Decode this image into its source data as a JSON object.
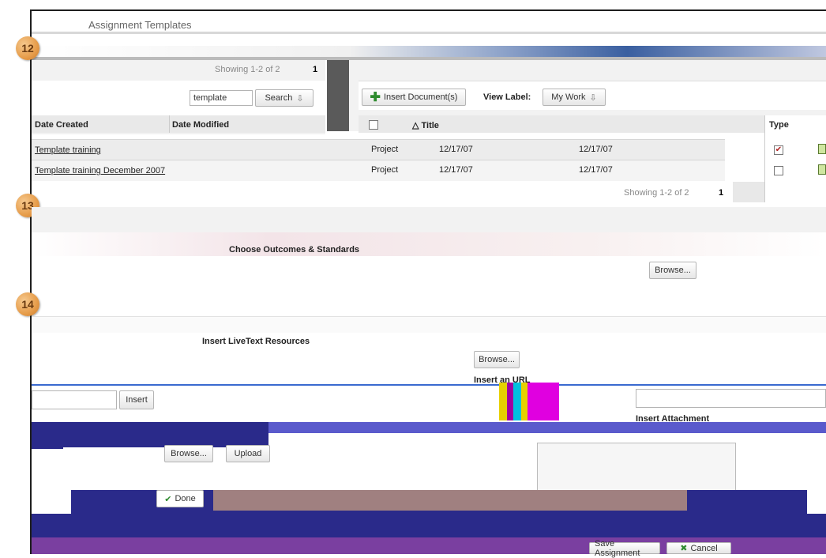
{
  "callouts": [
    "12",
    "13",
    "14"
  ],
  "header": {
    "title": "Assignment Templates"
  },
  "left_panel": {
    "pager_text": "Showing 1-2 of 2",
    "pager_page": "1",
    "search_value": "template",
    "search_label": "Search",
    "columns": {
      "created": "Date Created",
      "modified": "Date Modified"
    },
    "rows": [
      {
        "name": "Template training"
      },
      {
        "name": "Template training December 2007"
      }
    ]
  },
  "docs_panel": {
    "insert_label": "Insert Document(s)",
    "view_label_caption": "View Label:",
    "view_label_value": "My Work",
    "columns": {
      "title": "Title",
      "type": "Type"
    },
    "rows": [
      {
        "type": "Project",
        "created": "12/17/07",
        "modified": "12/17/07",
        "checked": true
      },
      {
        "type": "Project",
        "created": "12/17/07",
        "modified": "12/17/07",
        "checked": false
      }
    ],
    "pager_text": "Showing 1-2 of 2",
    "pager_page": "1"
  },
  "outcomes": {
    "heading": "Choose Outcomes & Standards",
    "browse_label": "Browse..."
  },
  "insert_section": {
    "heading": "Insert LiveText Resources",
    "browse_label": "Browse...",
    "url_heading": "Insert an URL",
    "insert_label": "Insert",
    "attach_heading": "Insert Attachment"
  },
  "upload": {
    "browse_label": "Browse...",
    "upload_label": "Upload",
    "done_label": "Done"
  },
  "footer": {
    "save_label": "Save Assignment",
    "cancel_label": "Cancel"
  },
  "colors": {
    "callout": "#e69c4a",
    "navy": "#2a2a8a",
    "accent_green": "#2e8b2e",
    "magenta": "#e000e0"
  }
}
